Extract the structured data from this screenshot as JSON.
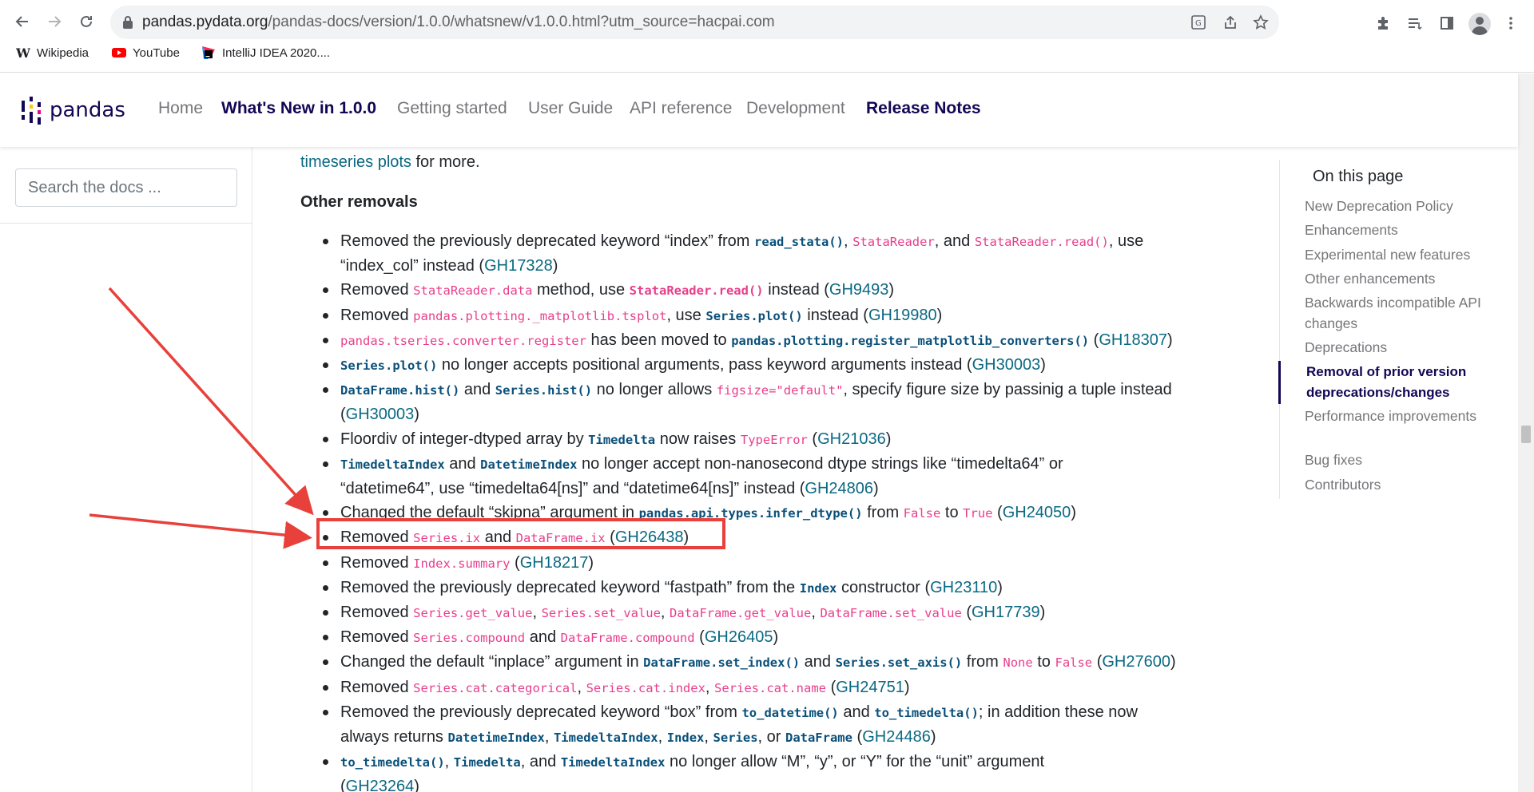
{
  "browser": {
    "url_host": "pandas.pydata.org",
    "url_path": "/pandas-docs/version/1.0.0/whatsnew/v1.0.0.html?utm_source=hacpai.com",
    "bookmarks": [
      {
        "label": "Wikipedia",
        "icon": "wikipedia-icon"
      },
      {
        "label": "YouTube",
        "icon": "youtube-icon"
      },
      {
        "label": "IntelliJ IDEA 2020....",
        "icon": "intellij-icon"
      }
    ]
  },
  "header": {
    "logo_text": "pandas",
    "nav": [
      "Home",
      "What's New in 1.0.0",
      "Getting started",
      "User Guide",
      "API reference",
      "Development",
      "Release Notes"
    ]
  },
  "sidebar": {
    "search_placeholder": "Search the docs ..."
  },
  "content": {
    "first_line_link": "timeseries plots",
    "first_line_rest": " for more.",
    "section_title": "Other removals"
  },
  "toc": {
    "title": "On this page",
    "items": [
      "New Deprecation Policy",
      "Enhancements",
      "Experimental new features",
      "Other enhancements",
      "Backwards incompatible API changes",
      "Deprecations",
      "Removal of prior version deprecations/changes",
      "Performance improvements",
      "Bug fixes",
      "Contributors"
    ],
    "active_index": 6
  },
  "colors": {
    "brand": "#130654",
    "link": "#0a6983",
    "code_red": "#e83e8c",
    "code_blue": "#0a507a",
    "annotation": "#e8403a"
  }
}
